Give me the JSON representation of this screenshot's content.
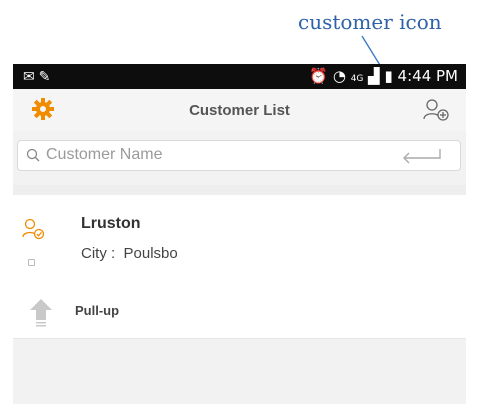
{
  "annotation": {
    "text": "customer icon",
    "color": "#2f63a9"
  },
  "status_bar": {
    "time": "4:44 PM",
    "network": "4G"
  },
  "header": {
    "title": "Customer List",
    "accent": "#f08c00",
    "left_icon": "gear-icon",
    "right_icon": "add-customer-icon"
  },
  "search": {
    "placeholder": "Customer Name",
    "icon": "search-icon",
    "action_icon": "enter-icon"
  },
  "customers": [
    {
      "name": "Lruston",
      "city_label": "City :  Poulsbo",
      "icon": "customer-icon"
    }
  ],
  "pull_up": {
    "label": "Pull-up",
    "icon": "arrow-up-icon"
  }
}
